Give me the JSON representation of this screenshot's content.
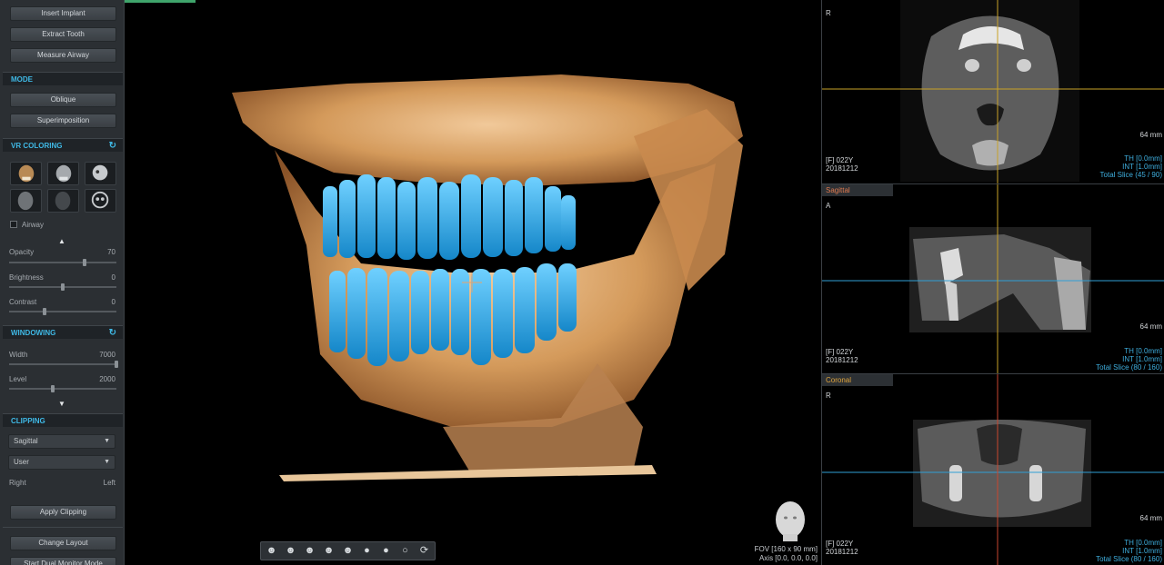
{
  "left": {
    "buttons_top": [
      "Insert Implant",
      "Extract Tooth",
      "Measure Airway"
    ],
    "mode": {
      "title": "MODE",
      "buttons": [
        "Oblique",
        "Superimposition"
      ]
    },
    "vr_coloring": {
      "title": "VR COLORING",
      "airway_label": "Airway",
      "sliders": [
        {
          "label": "Opacity",
          "value": "70",
          "fraction": 0.7
        },
        {
          "label": "Brightness",
          "value": "0",
          "fraction": 0.5
        },
        {
          "label": "Contrast",
          "value": "0",
          "fraction": 0.33
        }
      ]
    },
    "windowing": {
      "title": "WINDOWING",
      "sliders": [
        {
          "label": "Width",
          "value": "7000",
          "fraction": 1.0
        },
        {
          "label": "Level",
          "value": "2000",
          "fraction": 0.41
        }
      ]
    },
    "clipping": {
      "title": "CLIPPING",
      "plane_select": "Sagittal",
      "mode_select": "User",
      "side_left_label": "Right",
      "side_right_label": "Left",
      "apply_button": "Apply Clipping"
    },
    "bottom_buttons": [
      "Change Layout",
      "Start Dual Monitor Mode"
    ]
  },
  "main_view": {
    "fov_text": "FOV [160 x 90 mm]",
    "axis_text": "Axis [0.0, 0.0, 0.0]",
    "toolbar_icons": [
      "head-front-icon",
      "head-left-icon",
      "head-right-icon",
      "head-top-icon",
      "head-bottom-icon",
      "head-back-icon",
      "head-oblique-icon",
      "sphere-icon",
      "rotate-icon"
    ]
  },
  "panes": {
    "axial": {
      "orientation": "R",
      "mm": "64 mm",
      "patient": "[F] 022Y",
      "date": "20181212",
      "th": "TH [0.0mm]",
      "int": "INT [1.0mm]",
      "slice": "Total Slice (45 / 90)"
    },
    "sagittal": {
      "title": "Sagittal",
      "orientation": "A",
      "mm": "64 mm",
      "patient": "[F] 022Y",
      "date": "20181212",
      "th": "TH [0.0mm]",
      "int": "INT [1.0mm]",
      "slice": "Total Slice (80 / 160)"
    },
    "coronal": {
      "title": "Coronal",
      "orientation": "R",
      "mm": "64 mm",
      "patient": "[F] 022Y",
      "date": "20181212",
      "th": "TH [0.0mm]",
      "int": "INT [1.0mm]",
      "slice": "Total Slice (80 / 160)"
    }
  },
  "colors": {
    "accent": "#3fb9e6",
    "sagittal_title": "#e07a4f",
    "coronal_title": "#e0a43c",
    "teeth": "#2ea8e6",
    "bone": "#d9a36a"
  }
}
